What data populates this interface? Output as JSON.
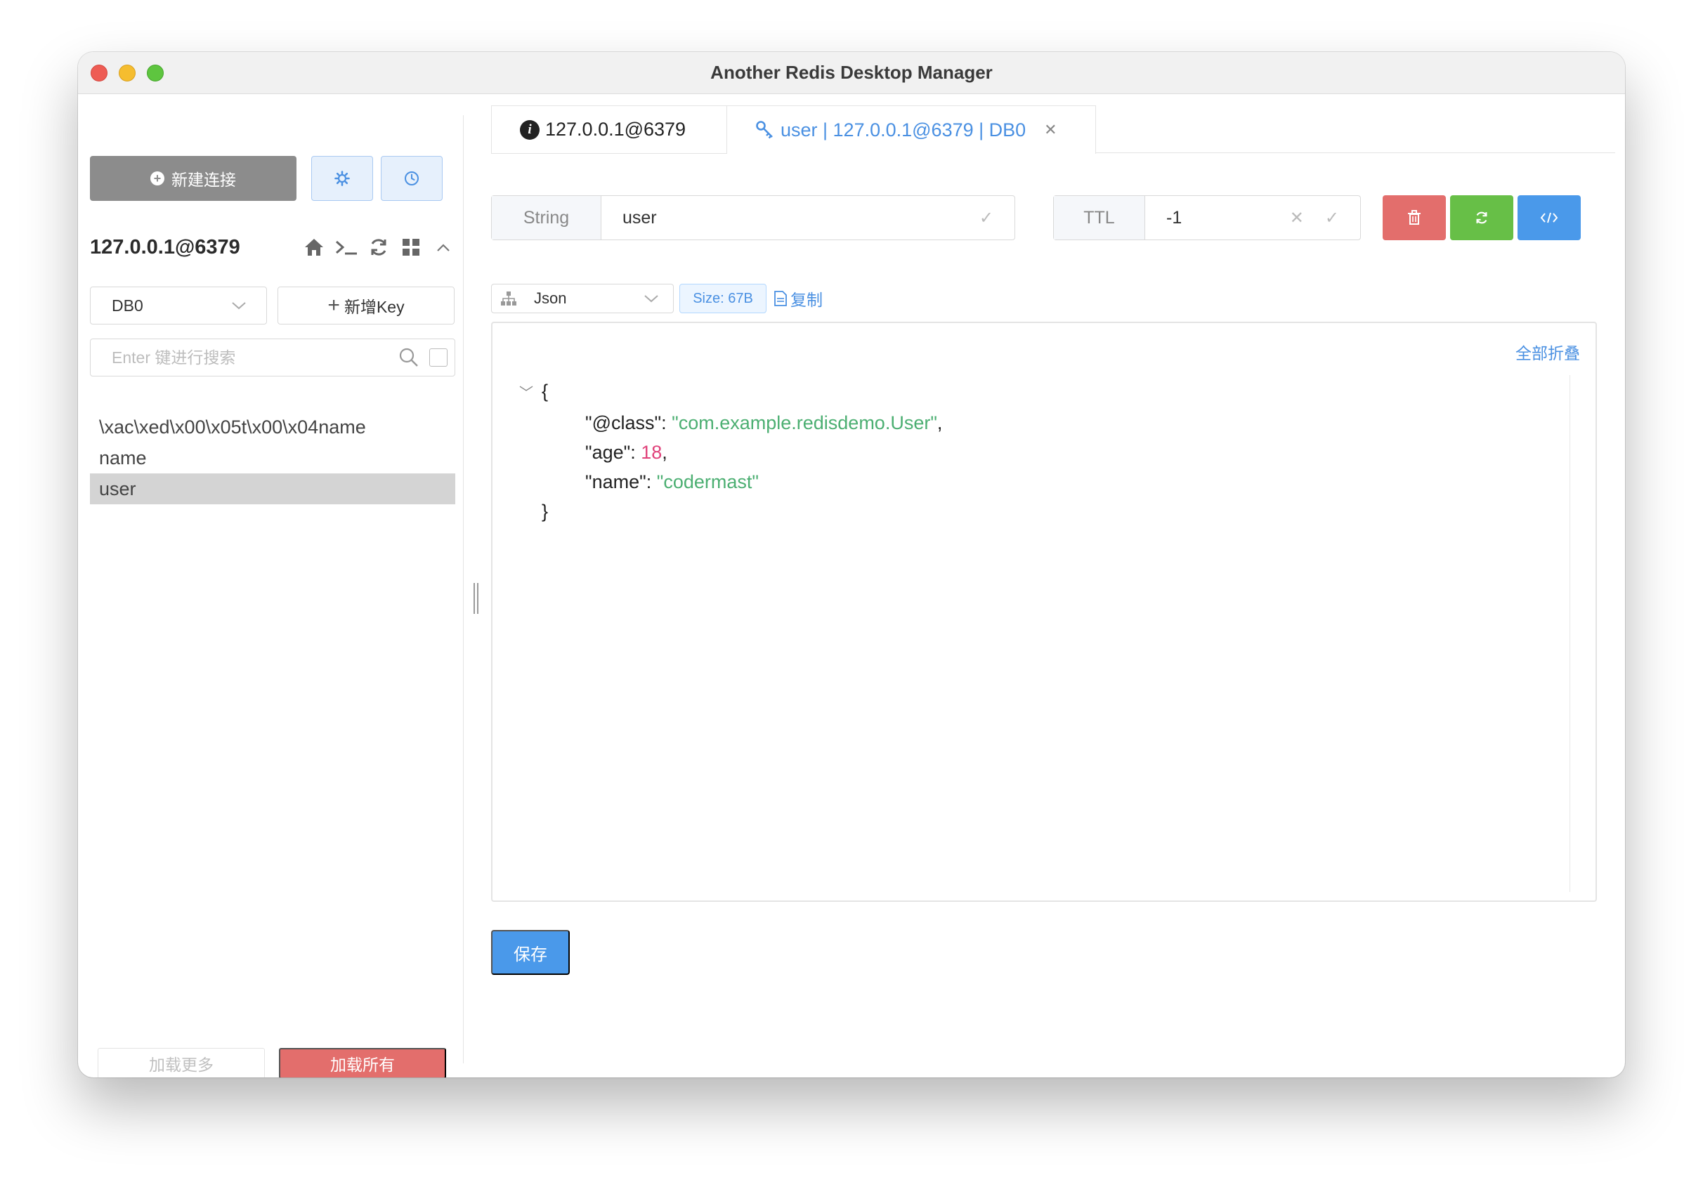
{
  "window": {
    "title": "Another Redis Desktop Manager"
  },
  "sidebar": {
    "new_connection_label": "新建连接",
    "connection_name": "127.0.0.1@6379",
    "db_selected": "DB0",
    "add_key_label": "新增Key",
    "search_placeholder": "Enter 键进行搜索",
    "keys": [
      "\\xac\\xed\\x00\\x05t\\x00\\x04name",
      "name",
      "user"
    ],
    "selected_key_index": 2,
    "load_more_label": "加载更多",
    "load_all_label": "加载所有"
  },
  "tabs": [
    {
      "label": "127.0.0.1@6379",
      "icon": "info-icon",
      "active": false
    },
    {
      "label": "user | 127.0.0.1@6379 | DB0",
      "icon": "key-icon",
      "active": true,
      "closable": true
    }
  ],
  "key_detail": {
    "type_label": "String",
    "key_name": "user",
    "ttl_label": "TTL",
    "ttl_value": "-1",
    "format": "Json",
    "size": "Size: 67B",
    "copy_label": "复制",
    "collapse_all_label": "全部折叠",
    "json_open": "{",
    "json_close": "}",
    "json_entries": [
      {
        "key": "\"@class\"",
        "value": "\"com.example.redisdemo.User\"",
        "kind": "str",
        "trail": ","
      },
      {
        "key": "\"age\"",
        "value": "18",
        "kind": "num",
        "trail": ","
      },
      {
        "key": "\"name\"",
        "value": "\"codermast\"",
        "kind": "str",
        "trail": ""
      }
    ],
    "save_label": "保存"
  },
  "colors": {
    "accent": "#4a99ea",
    "danger": "#e36e6c",
    "success": "#67bf47",
    "json_string": "#4caf72",
    "json_number": "#e0427a"
  }
}
